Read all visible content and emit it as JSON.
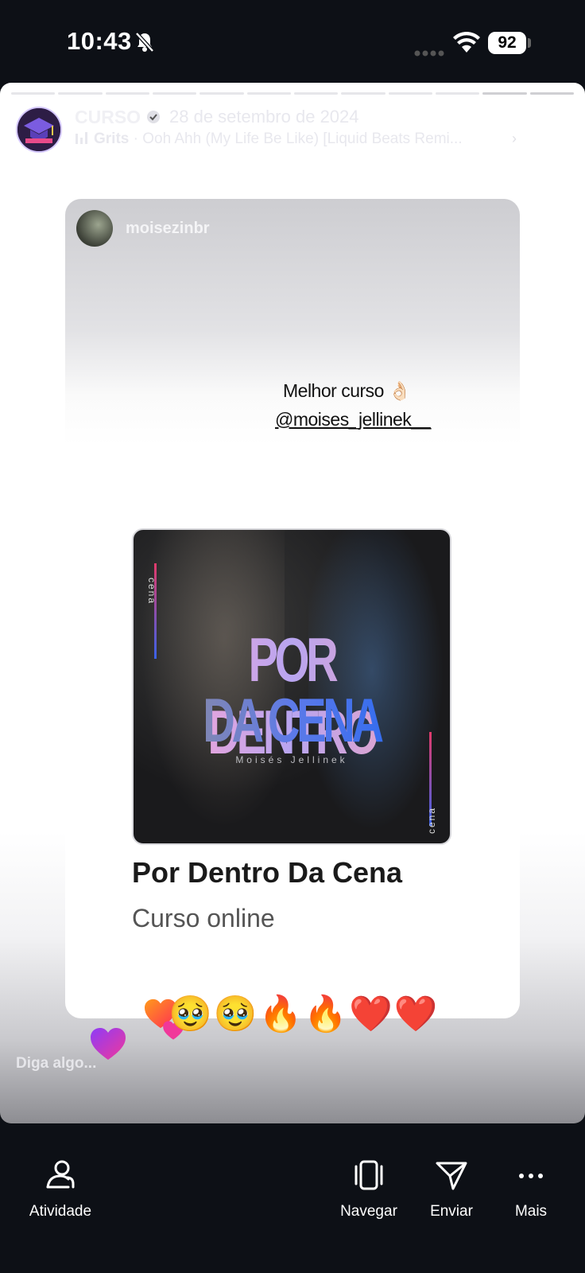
{
  "status_bar": {
    "time": "10:43",
    "battery": "92",
    "icons": [
      "bell-slash-icon",
      "signal-icon",
      "wifi-icon",
      "battery-icon"
    ]
  },
  "story": {
    "account_name": "CURSO",
    "date": "28 de setembro de 2024",
    "music_artist": "Grits",
    "music_track": " · Ooh Ahh (My Life Be Like) [Liquid Beats Remi...",
    "progress": {
      "segments": 12,
      "completed": 10
    }
  },
  "post": {
    "username": "moisezinbr",
    "caption_line1": "Melhor curso 👌🏻",
    "caption_line2": "@moises_jellinek__",
    "cover": {
      "title_line1": "POR DENTRO",
      "title_line2": "DA CENA",
      "author": "Moisés Jellinek",
      "tag": "cena"
    },
    "course_title": "Por Dentro Da Cena",
    "course_subtitle": "Curso online"
  },
  "reactions": "🥹🥹🔥🔥❤️❤️",
  "reply_placeholder": "Diga algo...",
  "toolbar": {
    "activity": "Atividade",
    "browse": "Navegar",
    "send": "Enviar",
    "more": "Mais"
  },
  "colors": {
    "background": "#0d1016",
    "accent_gradient_pink": "#e23a6a",
    "accent_gradient_blue": "#3a62e8"
  }
}
